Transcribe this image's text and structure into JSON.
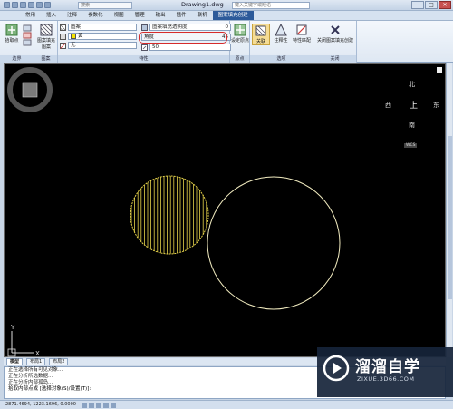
{
  "titlebar": {
    "search_placeholder": "搜索",
    "doc_title": "Drawing1.dwg",
    "help_placeholder": "键入关键字或短语",
    "min": "–",
    "max": "□",
    "close": "✕"
  },
  "tabs": [
    {
      "label": "常用",
      "active": false
    },
    {
      "label": "插入",
      "active": false
    },
    {
      "label": "注释",
      "active": false
    },
    {
      "label": "参数化",
      "active": false
    },
    {
      "label": "视图",
      "active": false
    },
    {
      "label": "管理",
      "active": false
    },
    {
      "label": "输出",
      "active": false
    },
    {
      "label": "插件",
      "active": false
    },
    {
      "label": "联机",
      "active": false
    },
    {
      "label": "图案填充创建",
      "active": true
    }
  ],
  "ribbon": {
    "boundary": {
      "pick_label": "拾取点",
      "panel": "边界"
    },
    "pattern": {
      "label": "图案填充图案",
      "panel": "图案"
    },
    "properties": {
      "type": "图案",
      "color": "黄",
      "bg": "无",
      "transparency_label": "图案填充透明度",
      "transparency_value": "0",
      "angle_label": "角度",
      "angle_value": "45",
      "scale_value": "50",
      "panel": "特性"
    },
    "origin": {
      "label": "设定原点",
      "panel": "原点"
    },
    "options": {
      "assoc": "关联",
      "annot": "注释性",
      "match": "特性匹配",
      "panel": "选项"
    },
    "close": {
      "label": "关闭图案填充创建",
      "panel": "关闭"
    }
  },
  "viewcube": {
    "north": "北",
    "south": "南",
    "east": "东",
    "west": "西",
    "top": "上",
    "wcs": "WCS"
  },
  "layout_tabs": [
    "模型",
    "布局1",
    "布局2"
  ],
  "command": {
    "lines": [
      "正在选择所有可见对象...",
      "正在分析所选数据...",
      "正在分析内部孤岛..."
    ],
    "prompt": "拾取内部点或 [选择对象(S)/设置(T)]:"
  },
  "status": {
    "coords": "2871.4694, 1223.1696, 0.0000"
  },
  "watermark": {
    "name": "溜溜自学",
    "url": "ZIXUE.3D66.COM"
  },
  "colors": {
    "hatch": "#e5d24a",
    "circle": "#f2ecc0",
    "accent": "#2c5a9a"
  }
}
